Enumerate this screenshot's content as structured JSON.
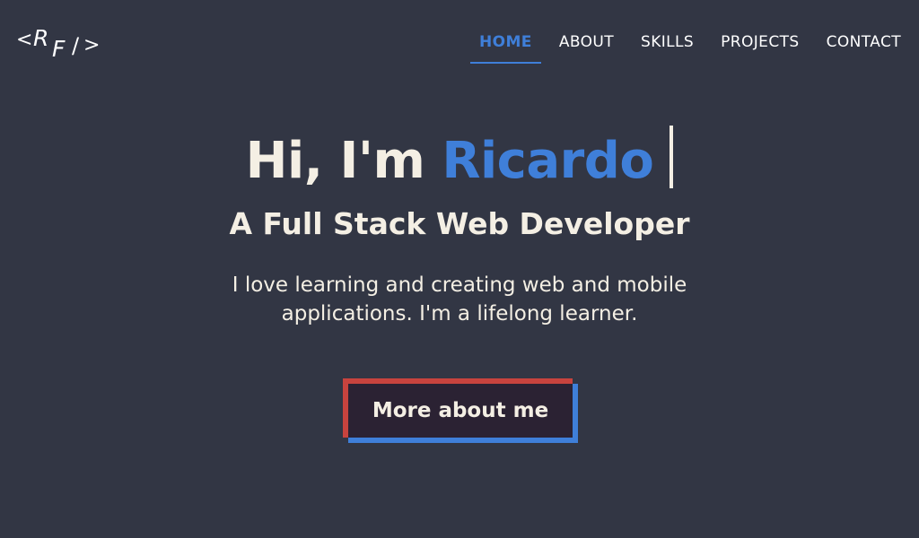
{
  "header": {
    "logo": {
      "lt": "<",
      "r": "R",
      "f": "F",
      "slash": "/",
      "gt": ">"
    },
    "nav": [
      {
        "label": "HOME",
        "active": true
      },
      {
        "label": "ABOUT",
        "active": false
      },
      {
        "label": "SKILLS",
        "active": false
      },
      {
        "label": "PROJECTS",
        "active": false
      },
      {
        "label": "CONTACT",
        "active": false
      }
    ]
  },
  "hero": {
    "greeting": "Hi, I'm ",
    "name": "Ricardo",
    "subtitle": "A Full Stack Web Developer",
    "description": "I love learning and creating web and mobile applications. I'm a lifelong learner.",
    "cta_label": "More about me"
  },
  "colors": {
    "background": "#323644",
    "accent_blue": "#3f7fd9",
    "accent_red": "#c8433e",
    "text": "#f4efe4",
    "button_bg": "#2b2233"
  }
}
